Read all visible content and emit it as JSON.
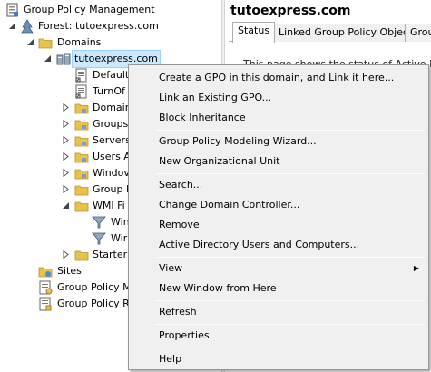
{
  "tree": {
    "root_label": "Group Policy Management",
    "forest_label": "Forest: tutoexpress.com",
    "domains_label": "Domains",
    "domain_label": "tutoexpress.com",
    "children": [
      {
        "label": "Default"
      },
      {
        "label": "TurnOf"
      },
      {
        "label": "Domair"
      },
      {
        "label": "Groups"
      },
      {
        "label": "Servers"
      },
      {
        "label": "Users A"
      },
      {
        "label": "Windov"
      },
      {
        "label": "Group I"
      },
      {
        "label": "WMI Fi"
      },
      {
        "label": "Win"
      },
      {
        "label": "Wir"
      },
      {
        "label": "Starter"
      }
    ],
    "sites_label": "Sites",
    "gpm_label": "Group Policy M",
    "gpr_label": "Group Policy R"
  },
  "right_pane": {
    "title": "tutoexpress.com",
    "tabs": [
      {
        "label": "Status"
      },
      {
        "label": "Linked Group Policy Objects"
      },
      {
        "label": "Group"
      }
    ],
    "body_text": "This page shows the status of Active Direct"
  },
  "context_menu": {
    "items": [
      {
        "label": "Create a GPO in this domain, and Link it here..."
      },
      {
        "label": "Link an Existing GPO..."
      },
      {
        "label": "Block Inheritance"
      },
      {
        "label": "Group Policy Modeling Wizard..."
      },
      {
        "label": "New Organizational Unit"
      },
      {
        "label": "Search..."
      },
      {
        "label": "Change Domain Controller..."
      },
      {
        "label": "Remove"
      },
      {
        "label": "Active Directory Users and Computers..."
      },
      {
        "label": "View"
      },
      {
        "label": "New Window from Here"
      },
      {
        "label": "Refresh"
      },
      {
        "label": "Properties"
      },
      {
        "label": "Help"
      }
    ],
    "submenu_arrow": "▶"
  },
  "colors": {
    "selection": "#cce8ff",
    "menu_background": "#f0f0f0",
    "folder": "#e8c24a"
  }
}
